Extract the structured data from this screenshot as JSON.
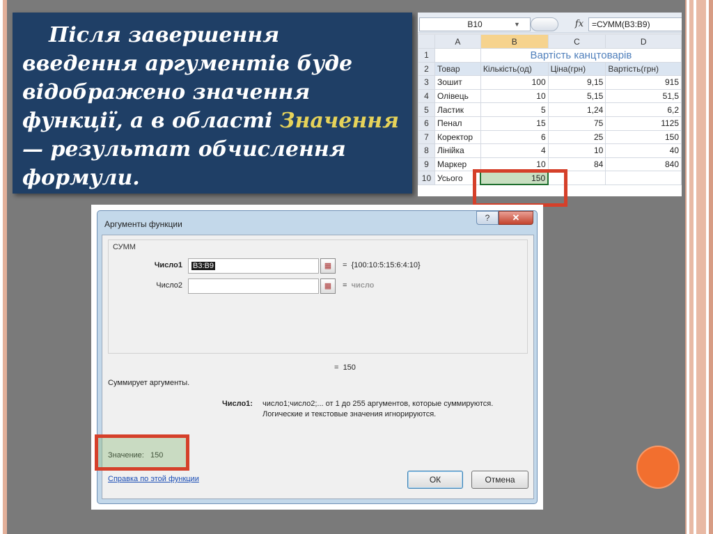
{
  "text_box": {
    "line_part1": "Після завершення введення аргументів буде відображено значення функції, а в області ",
    "highlight": "Значення",
    "line_part2": " — результат обчислення формули."
  },
  "sheet": {
    "name_box": "B10",
    "fx_label": "fx",
    "formula": "=СУММ(B3:B9)",
    "columns": [
      "A",
      "B",
      "C",
      "D"
    ],
    "title": "Вартість канцтоварів",
    "headers": [
      "Товар",
      "Кількість(од)",
      "Ціна(грн)",
      "Вартість(грн)"
    ],
    "rows": [
      {
        "n": "3",
        "item": "Зошит",
        "qty": "100",
        "price": "9,15",
        "cost": "915"
      },
      {
        "n": "4",
        "item": "Олівець",
        "qty": "10",
        "price": "5,15",
        "cost": "51,5"
      },
      {
        "n": "5",
        "item": "Ластик",
        "qty": "5",
        "price": "1,24",
        "cost": "6,2"
      },
      {
        "n": "6",
        "item": "Пенал",
        "qty": "15",
        "price": "75",
        "cost": "1125"
      },
      {
        "n": "7",
        "item": "Коректор",
        "qty": "6",
        "price": "25",
        "cost": "150"
      },
      {
        "n": "8",
        "item": "Лінійка",
        "qty": "4",
        "price": "10",
        "cost": "40"
      },
      {
        "n": "9",
        "item": "Маркер",
        "qty": "10",
        "price": "84",
        "cost": "840"
      }
    ],
    "total_row": {
      "n": "10",
      "label": "Усього",
      "value": "150"
    },
    "row_numbers": [
      "1",
      "2"
    ]
  },
  "dialog": {
    "title": "Аргументы функции",
    "help_symbol": "?",
    "close_symbol": "✕",
    "function_name": "СУММ",
    "arg1_label": "Число1",
    "arg1_value": "B3:B9",
    "arg1_result": "{100:10:5:15:6:4:10}",
    "arg2_label": "Число2",
    "arg2_value": "",
    "arg2_result": "число",
    "equals": "=",
    "formula_result": "150",
    "description": "Суммирует аргументы.",
    "arg_help_label": "Число1:",
    "arg_help_line1": "число1;число2;... от 1 до 255 аргументов, которые суммируются.",
    "arg_help_line2": "Логические и текстовые значения игнорируются.",
    "value_label": "Значение:",
    "value": "150",
    "help_link": "Справка по этой функции",
    "ok_label": "ОК",
    "cancel_label": "Отмена"
  },
  "colors": {
    "text_box_bg": "#1f3f66",
    "highlight_text": "#e6d35a",
    "red_frame": "#d5402a",
    "orange_dot": "#f26f2f"
  }
}
